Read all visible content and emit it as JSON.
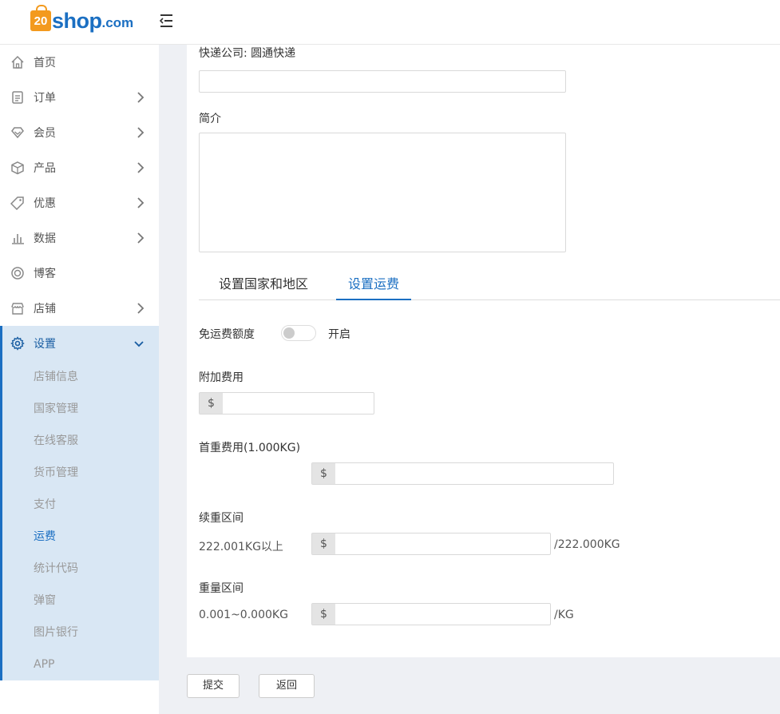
{
  "brand": {
    "logo_bag": "20",
    "logo_main": "shop",
    "logo_domain": ".com"
  },
  "sidebar": {
    "items": [
      {
        "label": "首页",
        "icon": "home-icon"
      },
      {
        "label": "订单",
        "icon": "order-icon"
      },
      {
        "label": "会员",
        "icon": "member-icon"
      },
      {
        "label": "产品",
        "icon": "product-icon"
      },
      {
        "label": "优惠",
        "icon": "tag-icon"
      },
      {
        "label": "数据",
        "icon": "chart-icon"
      },
      {
        "label": "博客",
        "icon": "blog-icon"
      },
      {
        "label": "店铺",
        "icon": "store-icon"
      }
    ],
    "settings": {
      "label": "设置",
      "icon": "gear-icon",
      "subitems": [
        "店铺信息",
        "国家管理",
        "在线客服",
        "货币管理",
        "支付",
        "运费",
        "统计代码",
        "弹窗",
        "图片银行",
        "APP"
      ],
      "active_subitem": "运费"
    }
  },
  "form": {
    "courier_label": "快递公司:",
    "courier_value": "圆通快递",
    "intro_label": "简介",
    "tabs": [
      "设置国家和地区",
      "设置运费"
    ],
    "active_tab": "设置运费",
    "free_shipping_label": "免运费额度",
    "free_shipping_toggle_text": "开启",
    "free_shipping_enabled": false,
    "extra_fee_label": "附加费用",
    "currency_symbol": "$",
    "first_weight_label": "首重费用(1.000KG)",
    "continued_weight_label": "续重区间",
    "continued_range": "222.001KG以上",
    "continued_unit": "/222.000KG",
    "weight_range_label": "重量区间",
    "weight_range": "0.001~0.000KG",
    "weight_unit": "/KG"
  },
  "actions": {
    "submit": "提交",
    "back": "返回"
  },
  "colors": {
    "accent": "#1b6fc2",
    "logo_orange": "#f39a1e",
    "sidebar_active_bg": "#d9e7f4",
    "page_bg": "#eef0f4"
  }
}
